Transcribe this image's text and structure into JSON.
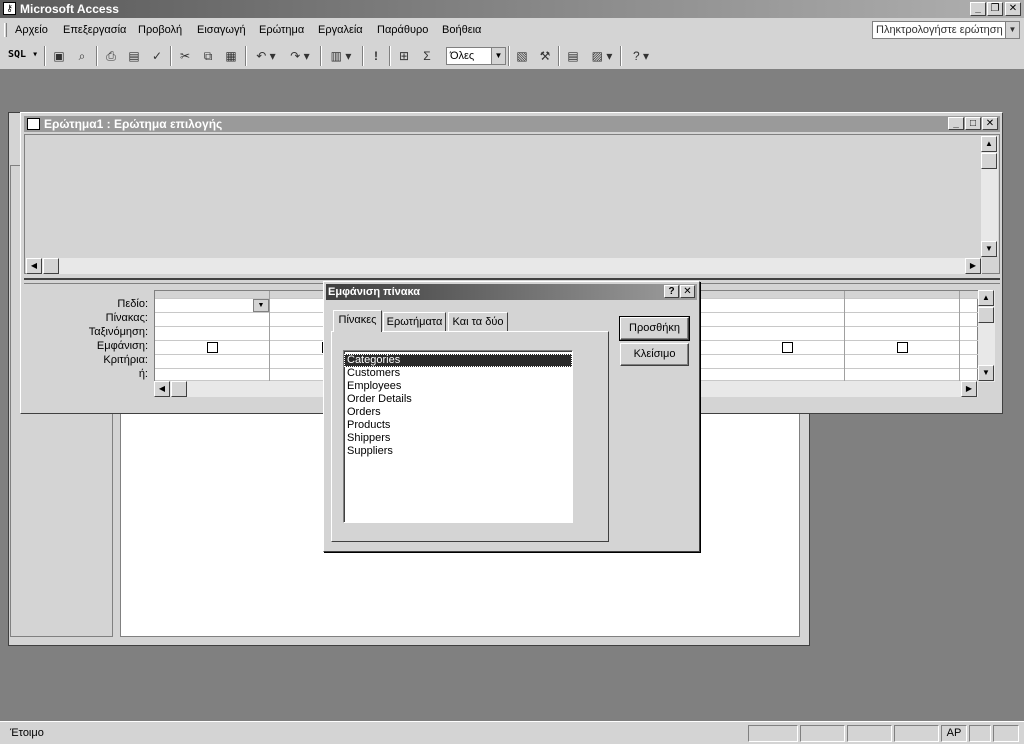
{
  "app": {
    "title": "Microsoft Access"
  },
  "menu": {
    "items": [
      "Αρχείο",
      "Επεξεργασία",
      "Προβολή",
      "Εισαγωγή",
      "Ερώτημα",
      "Εργαλεία",
      "Παράθυρο",
      "Βοήθεια"
    ],
    "ask_placeholder": "Πληκτρολογήστε ερώτηση"
  },
  "toolbar": {
    "sql_label": "SQL",
    "top_values": "Όλες",
    "sigma": "Σ",
    "run": "!"
  },
  "query_window": {
    "title": "Ερώτημα1 : Ερώτημα επιλογής",
    "row_labels": [
      "Πεδίο:",
      "Πίνακας:",
      "Ταξινόμηση:",
      "Εμφάνιση:",
      "Κριτήρια:",
      "ή:"
    ]
  },
  "dialog": {
    "title": "Εμφάνιση πίνακα",
    "help": "?",
    "close": "✕",
    "tabs": [
      "Πίνακες",
      "Ερωτήματα",
      "Και τα δύο"
    ],
    "tables": [
      "Categories",
      "Customers",
      "Employees",
      "Order Details",
      "Orders",
      "Products",
      "Shippers",
      "Suppliers"
    ],
    "selected_table": "Categories",
    "add_label": "Προσθήκη",
    "close_label": "Κλείσιμο"
  },
  "status": {
    "text": "Έτοιμο",
    "mode": "ΑΡ"
  }
}
